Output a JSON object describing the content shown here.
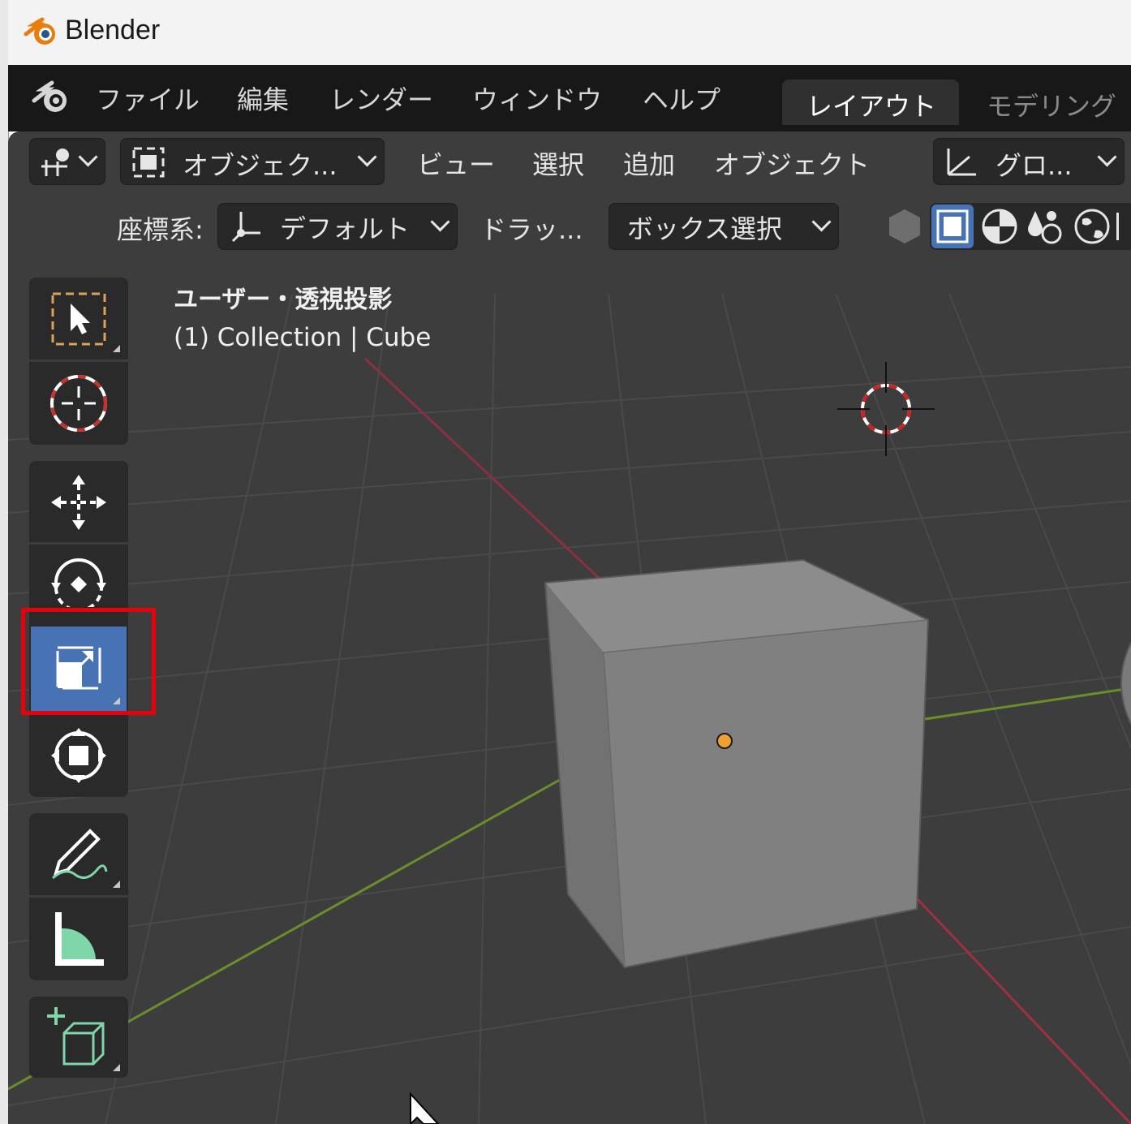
{
  "window": {
    "title": "Blender"
  },
  "menu": {
    "items": [
      "ファイル",
      "編集",
      "レンダー",
      "ウィンドウ",
      "ヘルプ"
    ],
    "workspace_tabs": [
      "レイアウト",
      "モデリング"
    ]
  },
  "header": {
    "mode_label": "オブジェク...",
    "menus": [
      "ビュー",
      "選択",
      "追加",
      "オブジェクト"
    ],
    "orientation_label": "グロ...",
    "coord_label": "座標系:",
    "coord_value": "デフォルト",
    "drag_label": "ドラッ...",
    "select_mode_value": "ボックス選択"
  },
  "viewport": {
    "view_name": "ユーザー・透視投影",
    "info": "(1) Collection | Cube"
  },
  "toolbar": {
    "tools": [
      "select-box-icon",
      "cursor-icon",
      "move-icon",
      "rotate-icon",
      "scale-icon",
      "transform-icon",
      "annotate-icon",
      "measure-icon",
      "add-cube-icon"
    ],
    "active_tool": "scale-icon"
  },
  "colors": {
    "accent": "#4772b3",
    "highlight": "#e8000b",
    "x_axis": "#a03040",
    "y_axis": "#6a8f2a",
    "origin": "#f0a030"
  }
}
